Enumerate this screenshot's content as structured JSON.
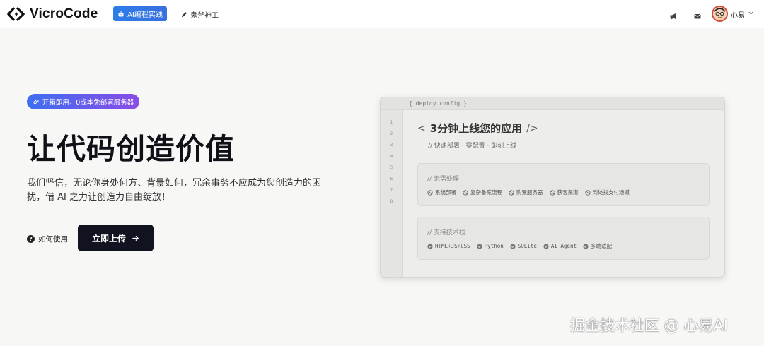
{
  "nav": {
    "brand": "VicroCode",
    "ai_practice": "AI编程实践",
    "tool_link": "鬼斧神工",
    "user_name": "心易"
  },
  "hero": {
    "badge": "开箱即用，0成本免部署服务器",
    "title": "让代码创造价值",
    "description": "我们坚信，无论你身处何方、背景如何，冗余事务不应成为您创造力的困扰，借 AI 之力让创造力自由绽放！",
    "howto": "如何使用",
    "upload_button": "立即上传"
  },
  "code_card": {
    "file_label": "{ deploy.config }",
    "line_numbers": [
      "1",
      "2",
      "3",
      "4",
      "5",
      "6",
      "7",
      "8"
    ],
    "title_open": "<",
    "title": "3分钟上线您的应用",
    "title_close": "/>",
    "subtitle": "// 快速部署 · 零配置 · 即刻上线",
    "panel_no_handle": {
      "heading": "// 无需处理",
      "items": [
        "系统部署",
        "复杂备案流程",
        "购置服务器",
        "获客渠道",
        "到处找支付通道"
      ]
    },
    "panel_stack": {
      "heading": "// 支持技术栈",
      "items": [
        "HTML+JS+CSS",
        "Python",
        "SQLite",
        "AI Agent",
        "多端适配"
      ]
    }
  },
  "watermark": "掘金技术社区 @ 心易AI",
  "colors": {
    "accent_blue": "#2b7de9",
    "badge_from": "#3e6ef1",
    "badge_to": "#8a4ce6",
    "button_dark": "#111420"
  }
}
